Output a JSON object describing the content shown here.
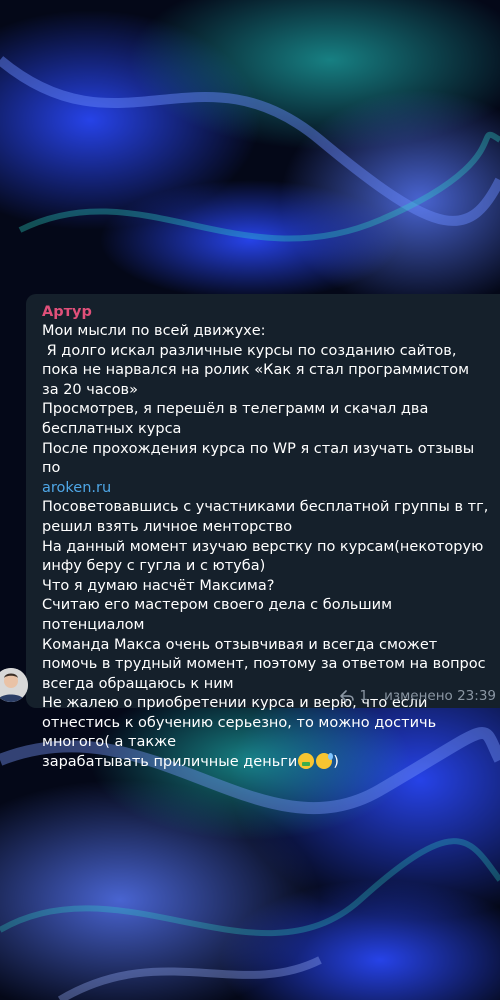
{
  "message": {
    "sender": "Артур",
    "lines": [
      "Мои мысли по всей движухе:",
      " Я долго искал различные курсы по созданию сайтов, пока не нарвался на ролик «Как я стал программистом за 20 часов»",
      "Просмотрев, я перешёл в телеграмм и скачал два бесплатных курса",
      "После прохождения курса по WP я стал изучать отзывы по"
    ],
    "link": "aroken.ru",
    "lines_after_link": [
      "Посоветовавшись с участниками бесплатной группы в тг, решил взять личное менторство",
      "На данный момент изучаю верстку по курсам(некоторую инфу беру с гугла и с ютуба)",
      "Что я думаю насчёт Максима?",
      "Считаю его мастером своего дела с большим потенциалом",
      "Команда Макса очень отзывчивая и всегда сможет помочь в трудный момент, поэтому за ответом на вопрос всегда обращаюсь к ним",
      "Не жалею о приобретении курса и верю, что если отнестись к обучению серьезно, то можно достичь многого( а также"
    ],
    "last_line_text": "зарабатывать приличные деньги",
    "last_line_end": ")",
    "emojis": [
      "money-mouth-face",
      "grinning-sweat-face"
    ],
    "reply_count": "1",
    "edited_time": "изменено 23:39"
  },
  "colors": {
    "sender": "#e0507a",
    "link": "#4ea6e6",
    "bubble": "#15202b",
    "meta": "#8a96a3"
  }
}
